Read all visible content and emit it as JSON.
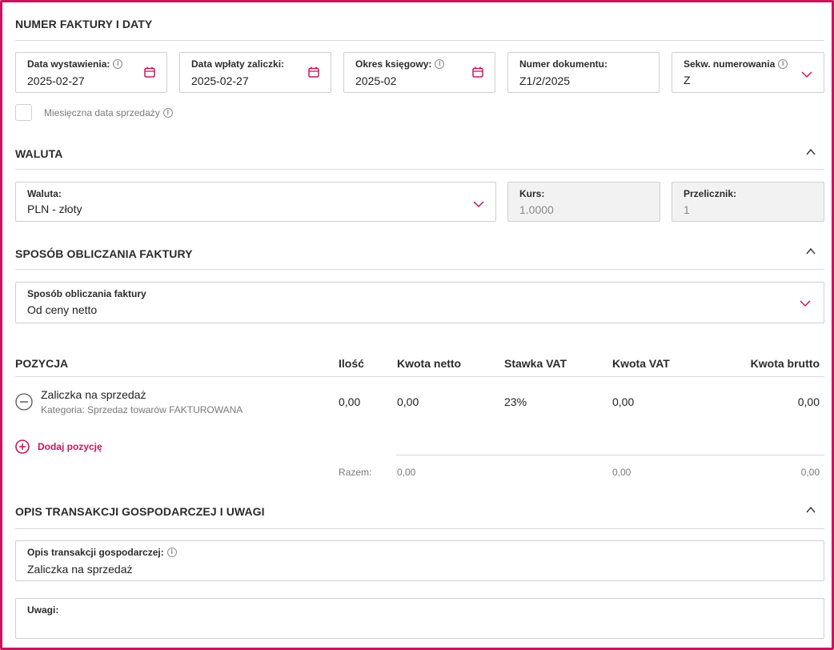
{
  "colors": {
    "accent": "#c8165f",
    "border": "#cfcfcf",
    "disabled_bg": "#f2f2f2"
  },
  "section_dates": {
    "title": "NUMER FAKTURY I DATY",
    "fields": [
      {
        "label": "Data wystawienia:",
        "value": "2025-02-27",
        "icon": "calendar-icon",
        "info": true
      },
      {
        "label": "Data wpłaty zaliczki:",
        "value": "2025-02-27",
        "icon": "calendar-icon",
        "info": false
      },
      {
        "label": "Okres księgowy:",
        "value": "2025-02",
        "icon": "calendar-icon",
        "info": true
      },
      {
        "label": "Numer dokumentu:",
        "value": "Z1/2/2025",
        "icon": "",
        "info": false
      },
      {
        "label": "Sekw. numerowania",
        "value": "Z",
        "icon": "chevron-down-icon",
        "info": true
      }
    ],
    "monthly_checkbox_label": "Miesięczna data sprzedaży",
    "monthly_checkbox_checked": false
  },
  "section_currency": {
    "title": "WALUTA",
    "currency": {
      "label": "Waluta:",
      "value": "PLN - złoty"
    },
    "rate": {
      "label": "Kurs:",
      "value": "1.0000"
    },
    "converter": {
      "label": "Przelicznik:",
      "value": "1"
    }
  },
  "section_calc": {
    "title": "SPOSÓB OBLICZANIA FAKTURY",
    "method": {
      "label": "Sposób obliczania faktury",
      "value": "Od ceny netto"
    }
  },
  "positions": {
    "headers": {
      "position": "POZYCJA",
      "qty": "Ilość",
      "net": "Kwota netto",
      "vat_rate": "Stawka VAT",
      "vat": "Kwota VAT",
      "gross": "Kwota brutto"
    },
    "rows": [
      {
        "name": "Zaliczka na sprzedaż",
        "category": "Kategoria: Sprzedaz towarów FAKTUROWANA",
        "qty": "0,00",
        "net": "0,00",
        "vat_rate": "23%",
        "vat": "0,00",
        "gross": "0,00"
      }
    ],
    "add_label": "Dodaj pozycję",
    "totals": {
      "label": "Razem:",
      "net": "0,00",
      "vat": "0,00",
      "gross": "0,00"
    }
  },
  "section_desc": {
    "title": "OPIS TRANSAKCJI GOSPODARCZEJ I UWAGI",
    "description": {
      "label": "Opis transakcji gospodarczej:",
      "value": "Zaliczka na sprzedaż"
    },
    "notes": {
      "label": "Uwagi:",
      "value": ""
    }
  }
}
